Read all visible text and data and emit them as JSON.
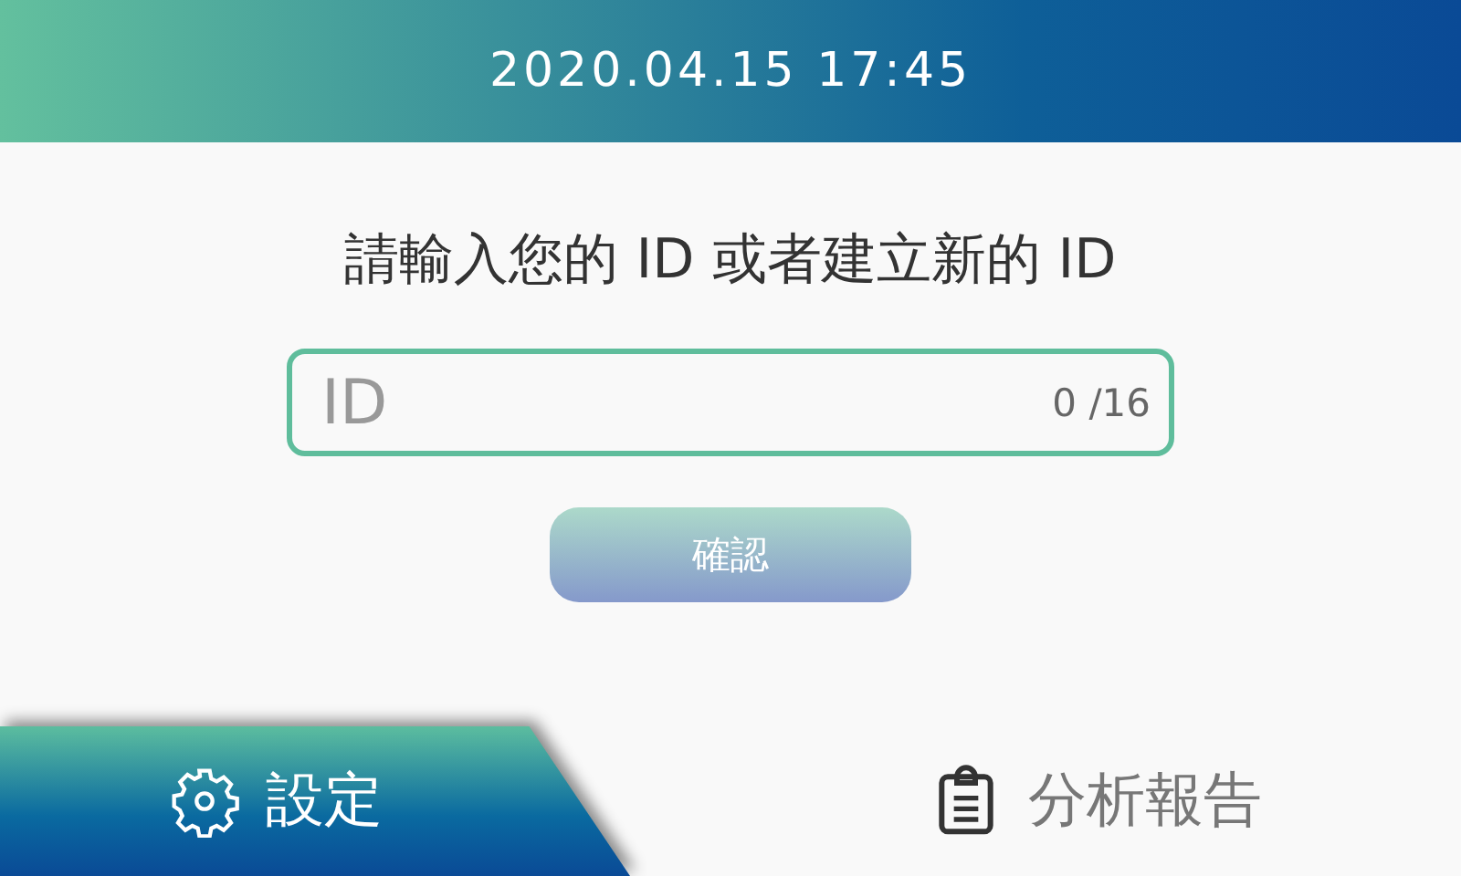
{
  "header": {
    "datetime": "2020.04.15 17:45"
  },
  "prompt": "請輸入您的 ID 或者建立新的 ID",
  "id_field": {
    "placeholder": "ID",
    "counter": "0 /16"
  },
  "confirm_button": {
    "label": "確認",
    "disabled": true
  },
  "tabs": [
    {
      "kind": "settings",
      "label": "設定",
      "selected": true
    },
    {
      "kind": "report",
      "label": "分析報告",
      "selected": false
    }
  ]
}
